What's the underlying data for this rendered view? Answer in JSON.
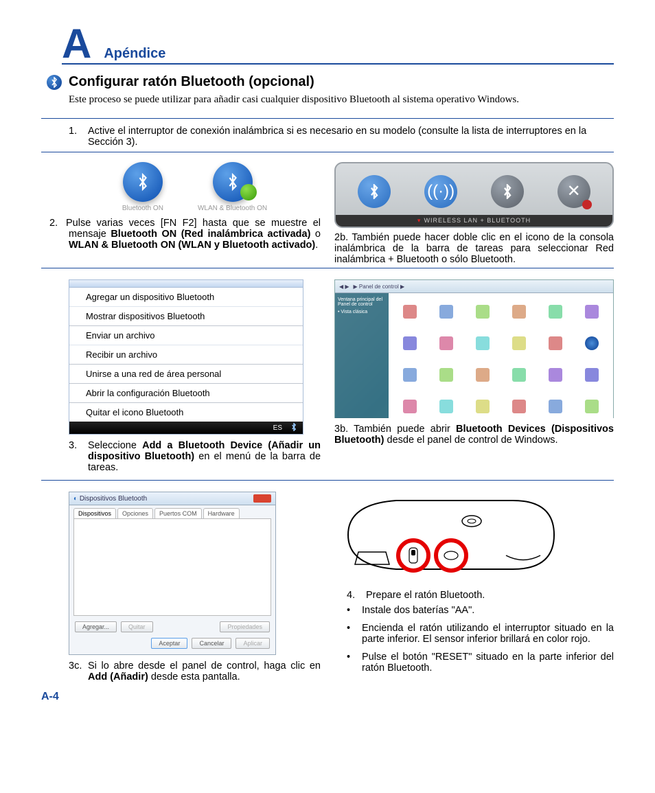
{
  "header": {
    "letter": "A",
    "label": "Apéndice"
  },
  "section": {
    "title": "Configurar ratón Bluetooth (opcional)",
    "intro": "Este proceso se puede utilizar para añadir casi cualquier dispositivo Bluetooth al sistema operativo Windows."
  },
  "step1": {
    "num": "1.",
    "text": "Active el interruptor de conexión inalámbrica si es necesario en su modelo (consulte la lista de interruptores en la Sección 3)."
  },
  "badges": {
    "b1": "Bluetooth ON",
    "b2": "WLAN & Bluetooth ON"
  },
  "console_label": "WIRELESS LAN + BLUETOOTH",
  "step2": {
    "num": "2.",
    "pre": "Pulse varias veces [FN F2] hasta que se muestre el mensaje ",
    "bold1": "Bluetooth ON (Red inalámbrica activada)",
    "mid": " o ",
    "bold2": "WLAN & Bluetooth ON (WLAN y Bluetooth activado)",
    "post": "."
  },
  "step2b": {
    "num": "2b.",
    "text": "También puede hacer doble clic en el icono de la consola inalámbrica de la barra de tareas para seleccionar Red inalámbrica + Bluetooth o sólo Bluetooth."
  },
  "menu": {
    "i1": "Agregar un dispositivo Bluetooth",
    "i2": "Mostrar dispositivos Bluetooth",
    "i3": "Enviar un archivo",
    "i4": "Recibir un archivo",
    "i5": "Unirse a una red de área personal",
    "i6": "Abrir la configuración Bluetooth",
    "i7": "Quitar el icono Bluetooth",
    "lang": "ES"
  },
  "vista": {
    "crumb": "▶ Panel de control ▶",
    "side1": "Ventana principal del Panel de control",
    "side2": "• Vista clásica"
  },
  "step3": {
    "num": "3.",
    "pre": "Seleccione ",
    "bold": "Add a Bluetooth Device (Añadir un dispositivo Bluetooth)",
    "post": " en el menú de la barra de tareas."
  },
  "step3b": {
    "num": "3b.",
    "pre": "También puede abrir ",
    "bold": "Bluetooth Devices (Dispositivos Bluetooth)",
    "post": " desde el panel de control de Windows."
  },
  "dialog": {
    "title": "Dispositivos Bluetooth",
    "tab1": "Dispositivos",
    "tab2": "Opciones",
    "tab3": "Puertos COM",
    "tab4": "Hardware",
    "btn_add": "Agregar...",
    "btn_remove": "Quitar",
    "btn_props": "Propiedades",
    "btn_ok": "Aceptar",
    "btn_cancel": "Cancelar",
    "btn_apply": "Aplicar"
  },
  "step3c": {
    "num": "3c.",
    "pre": "Si lo abre desde el panel de control, haga clic en ",
    "bold": "Add (Añadir)",
    "post": " desde esta pantalla."
  },
  "step4": {
    "num": "4.",
    "text": "Prepare el ratón Bluetooth.",
    "b1": "Instale dos baterías \"AA\".",
    "b2": "Encienda el ratón utilizando el interruptor situado en la parte inferior. El sensor inferior brillará en color rojo.",
    "b3": "Pulse el botón \"RESET\" situado en la parte inferior del ratón Bluetooth."
  },
  "page_num": "A-4"
}
